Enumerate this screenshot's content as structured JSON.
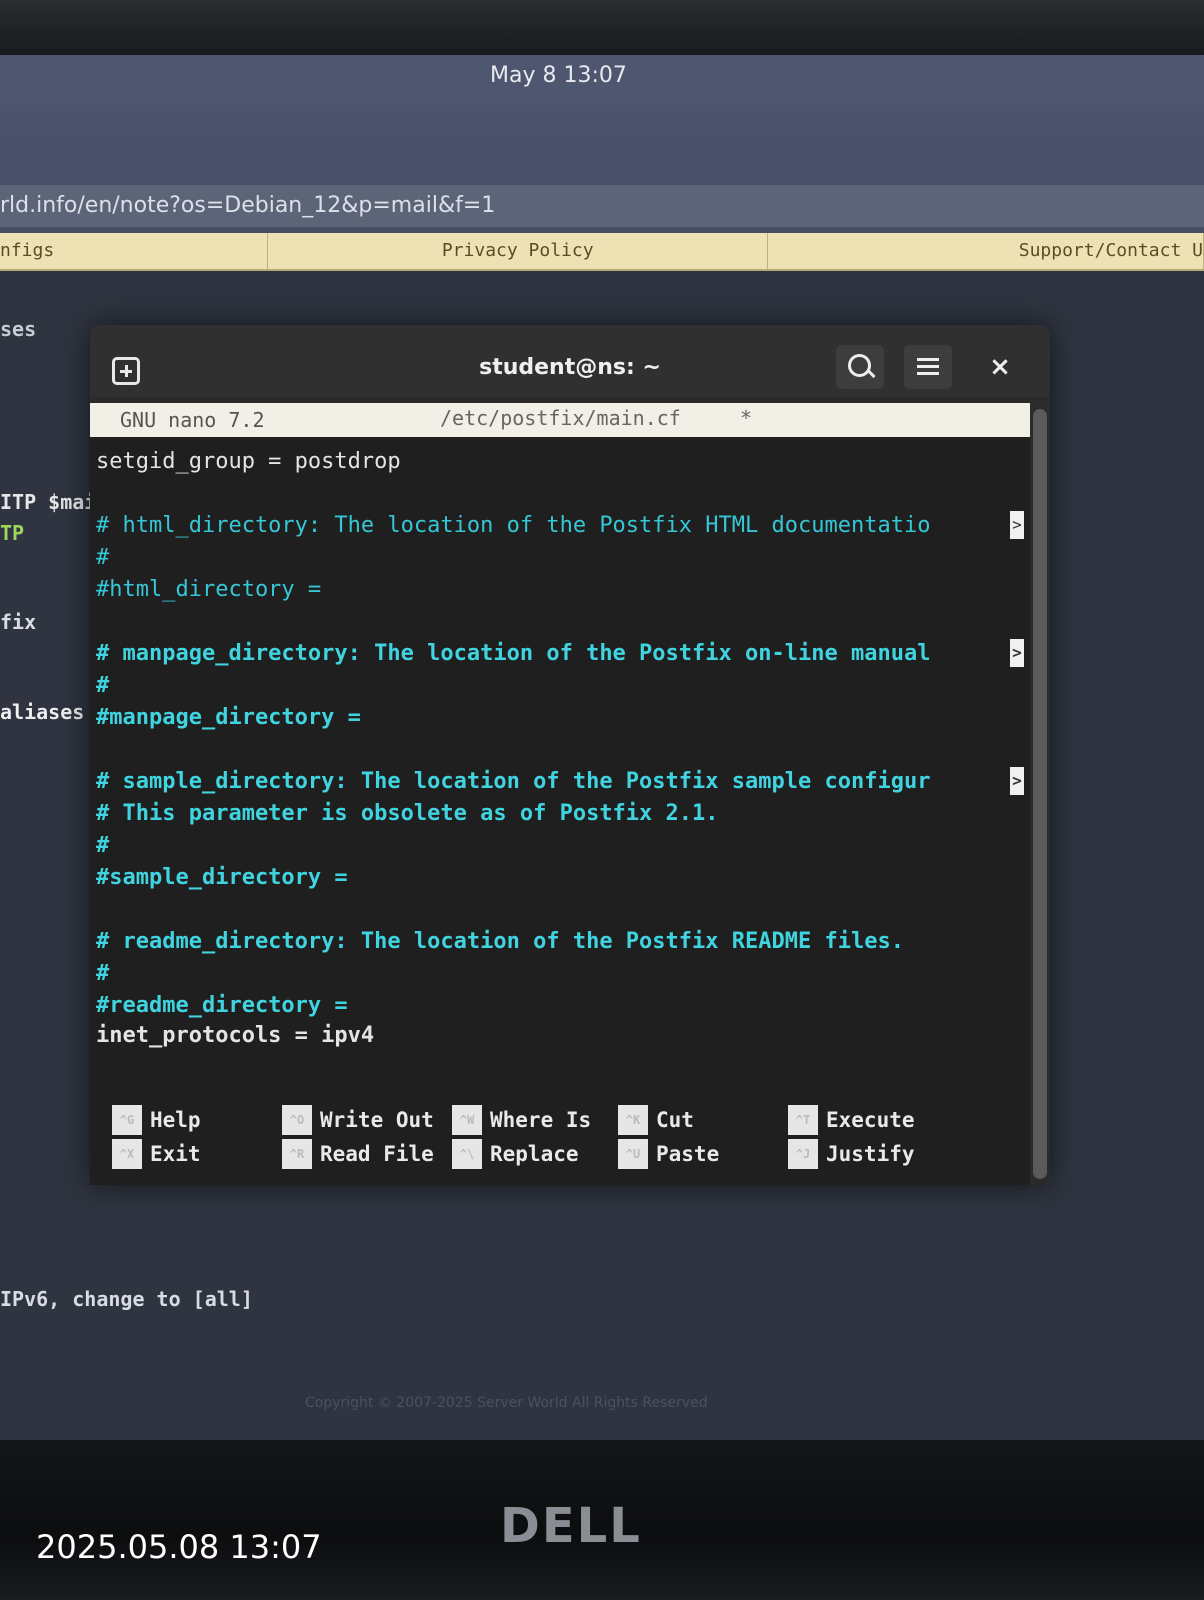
{
  "topbar": {
    "clock": "May 8 13:07"
  },
  "browser": {
    "url": "rld.info/en/note?os=Debian_12&p=mail&f=1",
    "nav": [
      "nfigs",
      "Privacy Policy",
      "Support/Contact U"
    ],
    "background_text": {
      "ses": "ses",
      "smtp": "ITP $mai",
      "tp": "TP",
      "fix": "fix",
      "aliases": "aliases",
      "ipv6": "IPv6, change to [all]",
      "copyright": "Copyright © 2007-2025 Server World All Rights Reserved"
    }
  },
  "terminal": {
    "title": "student@ns: ~",
    "nano": {
      "version": "GNU nano 7.2",
      "filename": "/etc/postfix/main.cf",
      "modified": "*",
      "lines": [
        "setgid_group = postdrop",
        "",
        "# html_directory: The location of the Postfix HTML documentatio",
        "#",
        "#html_directory =",
        "",
        "# manpage_directory: The location of the Postfix on-line manual",
        "#",
        "#manpage_directory =",
        "",
        "# sample_directory: The location of the Postfix sample configur",
        "# This parameter is obsolete as of Postfix 2.1.",
        "#",
        "#sample_directory =",
        "",
        "# readme_directory: The location of the Postfix README files.",
        "#",
        "#readme_directory =",
        "inet_protocols = ipv4"
      ],
      "truncation_marker": ">",
      "shortcuts": [
        {
          "key": "^G",
          "label": "Help"
        },
        {
          "key": "^X",
          "label": "Exit"
        },
        {
          "key": "^O",
          "label": "Write Out"
        },
        {
          "key": "^R",
          "label": "Read File"
        },
        {
          "key": "^W",
          "label": "Where Is"
        },
        {
          "key": "^\\",
          "label": "Replace"
        },
        {
          "key": "^K",
          "label": "Cut"
        },
        {
          "key": "^U",
          "label": "Paste"
        },
        {
          "key": "^T",
          "label": "Execute"
        },
        {
          "key": "^J",
          "label": "Justify"
        }
      ]
    }
  },
  "monitor": {
    "brand": "DELL"
  },
  "photo_timestamp": "2025.05.08 13:07"
}
